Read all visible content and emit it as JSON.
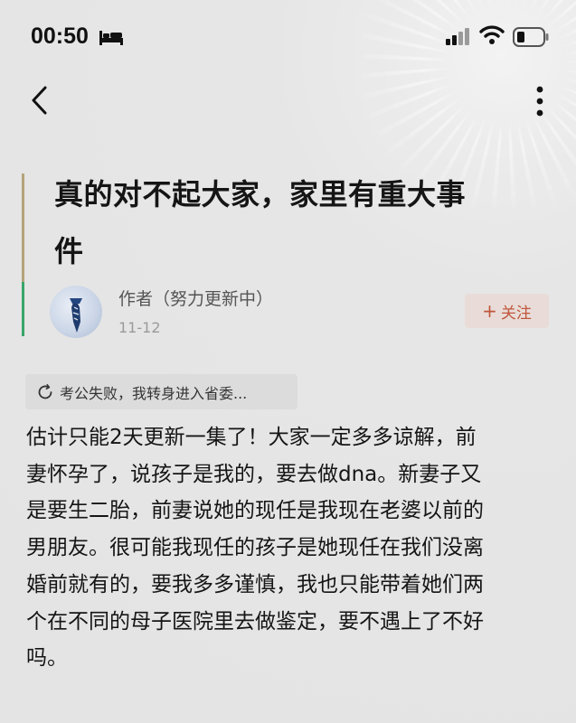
{
  "status_bar": {
    "time": "00:50"
  },
  "icons": {
    "bed": "bed-icon",
    "signal": "signal-icon",
    "wifi": "wifi-icon",
    "battery": "battery-icon",
    "back": "chevron-left-icon",
    "more": "more-vertical-icon",
    "refresh": "refresh-icon"
  },
  "article": {
    "title_lines": [
      "真的对不起大家，家里有重大事",
      "件"
    ],
    "author": "作者（努力更新中）",
    "date": "11-12",
    "follow_label": "关注",
    "chapter_link": "考公失败，我转身进入省委...",
    "body_lines": [
      "估计只能2天更新一集了！大家一定多多谅解，前",
      "妻怀孕了，说孩子是我的，要去做dna。新妻子又",
      "是要生二胎，前妻说她的现任是我现在老婆以前的",
      "男朋友。很可能我现任的孩子是她现任在我们没离",
      "婚前就有的，要我多多谨慎，我也只能带着她们两",
      "个在不同的母子医院里去做鉴定，要不遇上了不好",
      "吗。"
    ]
  },
  "colors": {
    "background": "#e7e7e7",
    "accent_follow": "#c0563c",
    "title_bar_tan": "#b5a37a",
    "title_bar_green": "#3aa56a"
  }
}
